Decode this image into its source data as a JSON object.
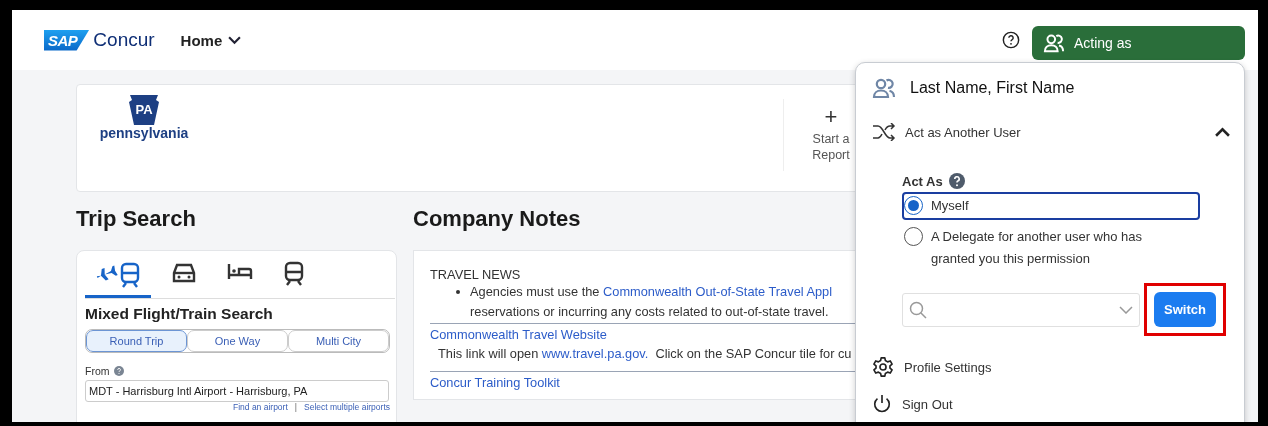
{
  "header": {
    "logo": {
      "badge": "SAP",
      "name": "Concur"
    },
    "menu": {
      "label": "Home"
    },
    "acting_button": {
      "label": "Acting as"
    }
  },
  "company_banner": {
    "logo": {
      "mark": "PA",
      "name": "pennsylvania"
    },
    "actions": [
      {
        "label": "Start a Report",
        "icon": "+"
      }
    ]
  },
  "trip_search": {
    "title": "Trip Search",
    "tabs": [
      {
        "kind": "flight-train",
        "selected": true
      },
      {
        "kind": "car",
        "selected": false
      },
      {
        "kind": "hotel",
        "selected": false
      },
      {
        "kind": "train",
        "selected": false
      }
    ],
    "heading": "Mixed Flight/Train Search",
    "trip_types": [
      {
        "label": "Round Trip",
        "selected": true
      },
      {
        "label": "One Way",
        "selected": false
      },
      {
        "label": "Multi City",
        "selected": false
      }
    ],
    "from": {
      "label": "From",
      "value": "MDT - Harrisburg Intl Airport - Harrisburg, PA"
    },
    "links": [
      {
        "label": "Find an airport"
      },
      {
        "label": "Select multiple airports"
      }
    ],
    "link_separator": "|"
  },
  "company_notes": {
    "title": "Company Notes",
    "sections": [
      {
        "kind": "news",
        "heading": "TRAVEL NEWS",
        "bullet_prefix": "Agencies must use the ",
        "bullet_link": "Commonwealth Out-of-State Travel Appl",
        "bullet_rest": "reservations or incurring any costs related to out-of-state travel."
      },
      {
        "kind": "link",
        "title": "Commonwealth Travel Website",
        "text_prefix": "This link will open ",
        "text_link": "www.travel.pa.gov.",
        "text_rest": "  Click on the SAP Concur tile for cu"
      },
      {
        "kind": "link",
        "title": "Concur Training Toolkit"
      }
    ]
  },
  "profile_menu": {
    "user": "Last Name, First Name",
    "act_as_section": {
      "label": "Act as Another User",
      "expanded": true,
      "field_label": "Act As",
      "options": [
        {
          "label": "Myself",
          "selected": true
        },
        {
          "label": "A Delegate for another user who has granted you this permission",
          "selected": false
        }
      ],
      "switch_button": "Switch",
      "switch_highlighted": true
    },
    "items": [
      {
        "kind": "settings",
        "label": "Profile Settings"
      },
      {
        "kind": "signout",
        "label": "Sign Out"
      }
    ]
  }
}
